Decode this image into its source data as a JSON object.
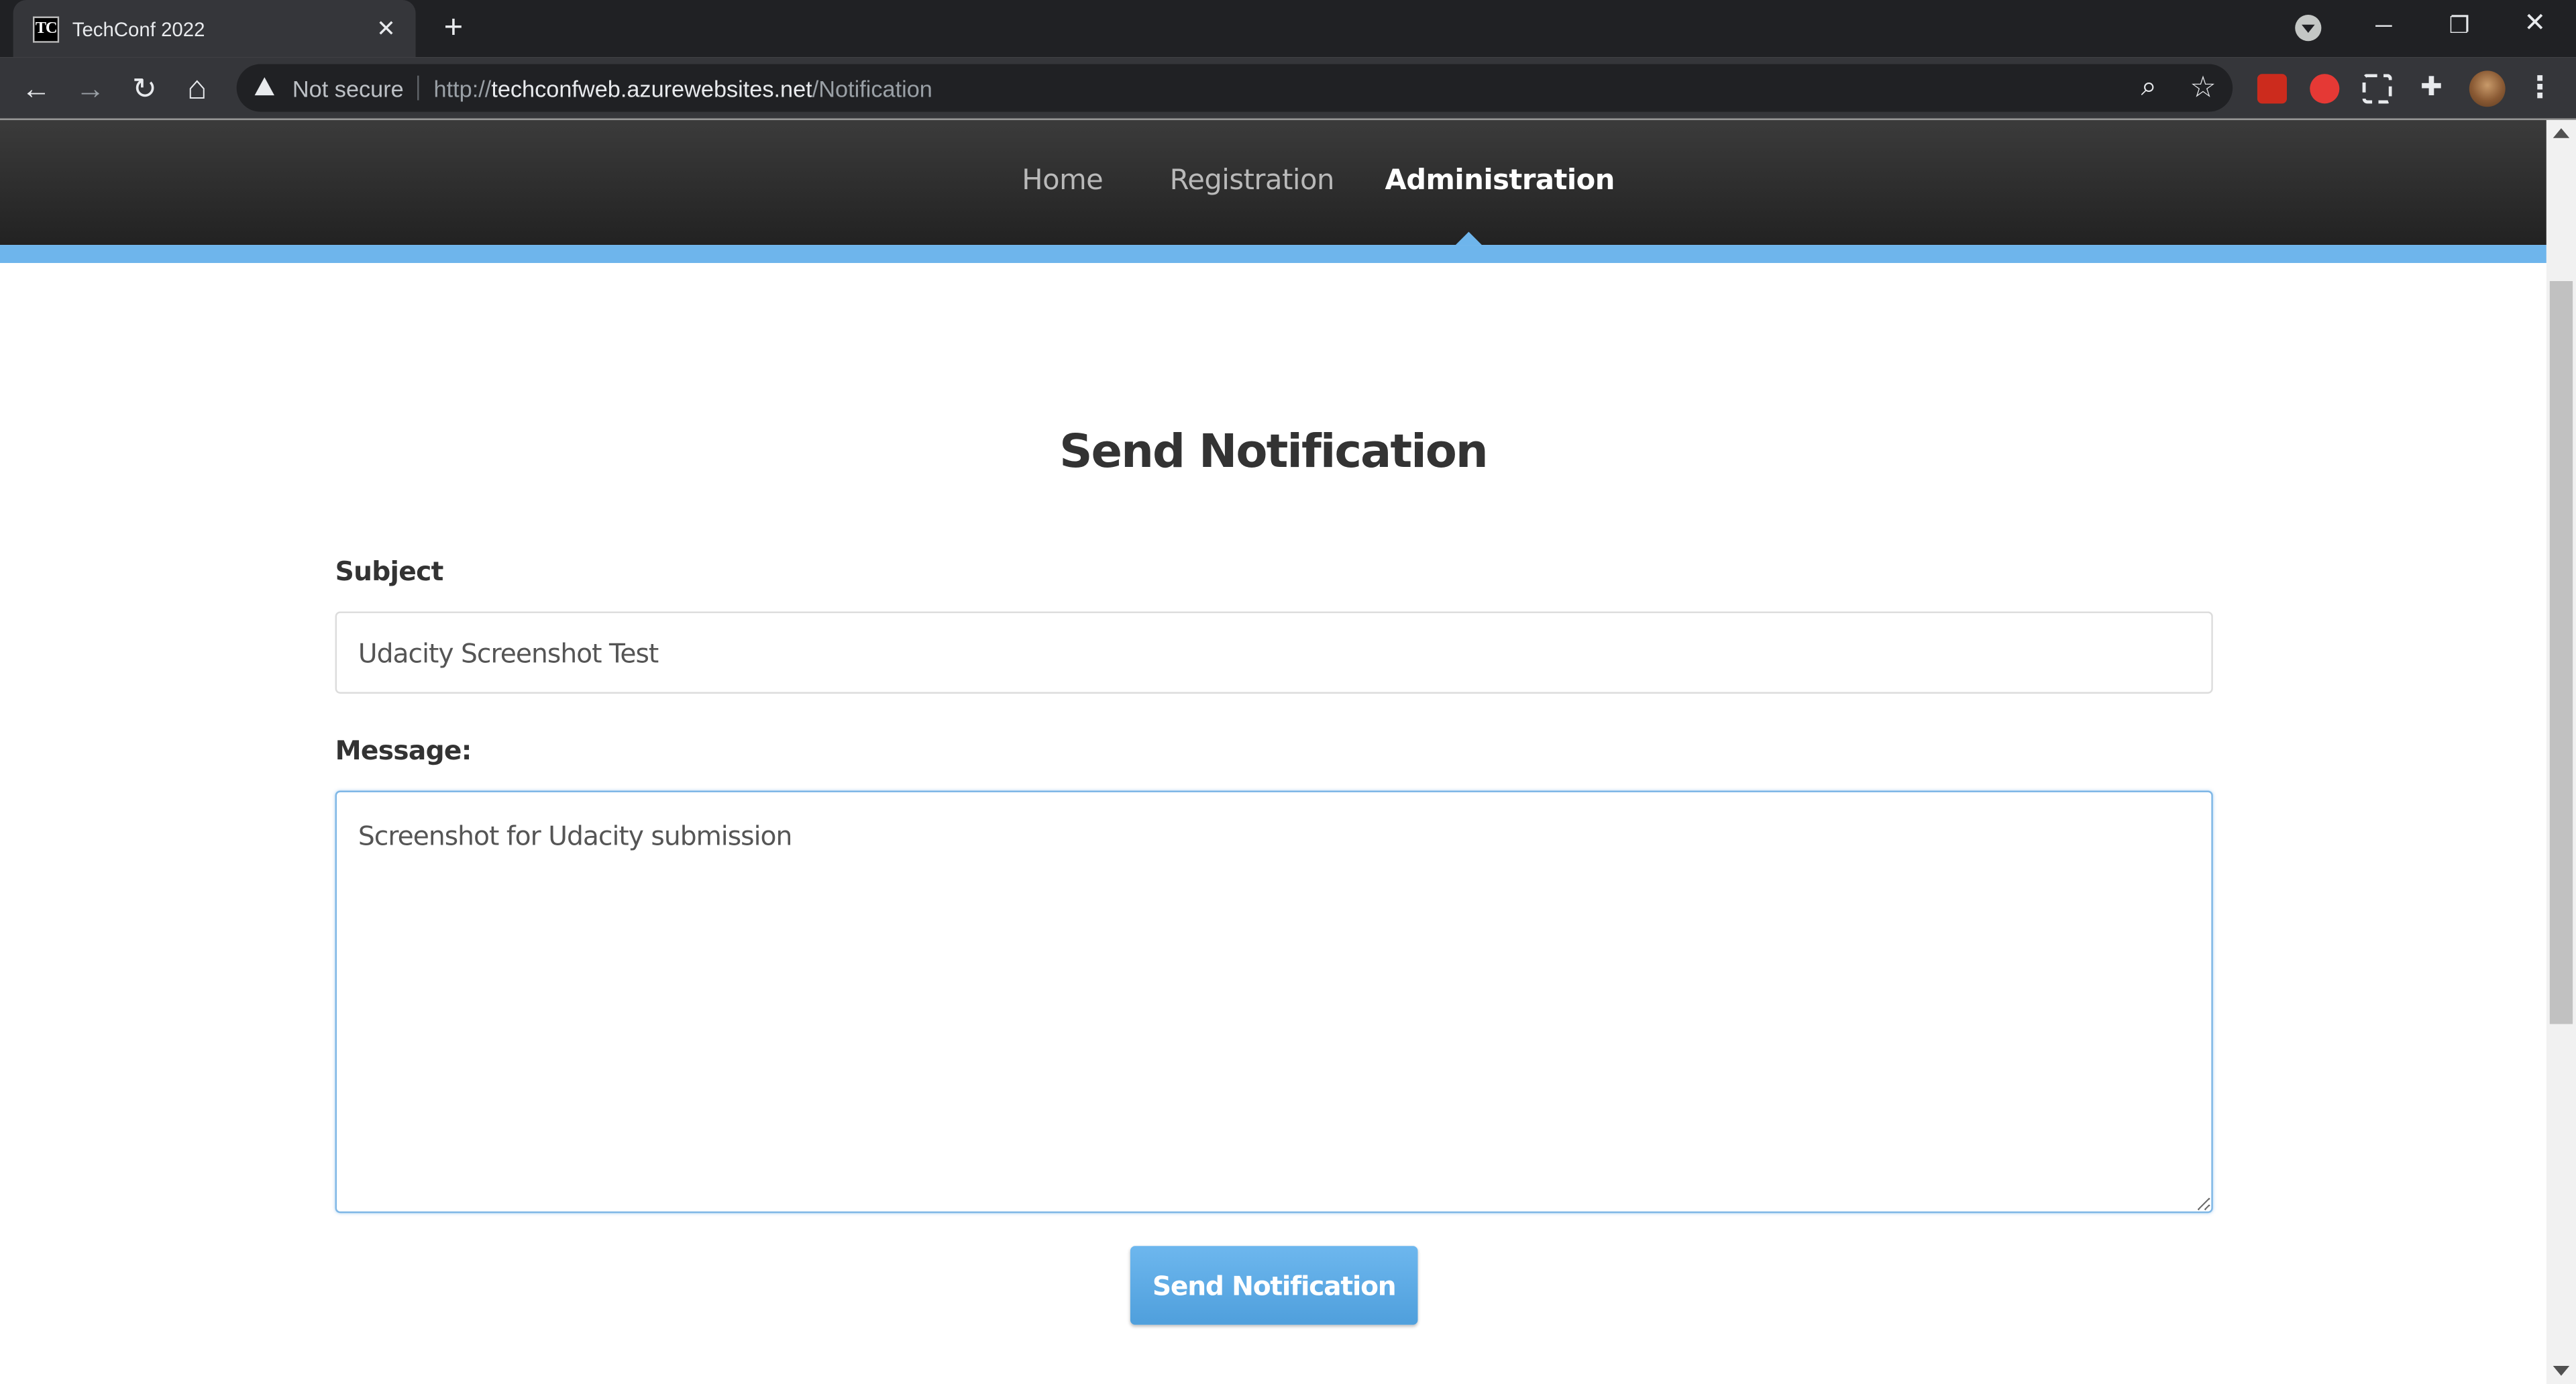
{
  "browser": {
    "tab": {
      "favicon_text": "TC",
      "title": "TechConf 2022",
      "close": "✕"
    },
    "new_tab": "+",
    "window_controls": {
      "minimize": "─",
      "restore": "❐",
      "close": "✕"
    },
    "nav": {
      "back": "←",
      "forward": "→",
      "reload": "↻",
      "home": "⌂"
    },
    "address": {
      "security_label": "Not secure",
      "scheme": "http://",
      "host": "techconfweb.azurewebsites.net",
      "path": "/Notification"
    },
    "omnibox_icons": {
      "zoom": "⌕",
      "bookmark": "☆"
    },
    "extensions": [
      {
        "name": "acrobat-extension-icon",
        "color": "#cc2b1d"
      },
      {
        "name": "adblock-extension-icon",
        "color": "#e53935"
      },
      {
        "name": "capture-extension-icon",
        "color": "#e8eaed"
      },
      {
        "name": "puzzle-extension-icon",
        "color": "#e8eaed"
      }
    ],
    "menu": "⋮"
  },
  "site_nav": {
    "items": [
      {
        "label": "Home",
        "active": false
      },
      {
        "label": "Registration",
        "active": false
      },
      {
        "label": "Administration",
        "active": true
      }
    ],
    "accent_color": "#6eb5ec"
  },
  "form": {
    "title": "Send Notification",
    "subject": {
      "label": "Subject",
      "value": "Udacity Screenshot Test"
    },
    "message": {
      "label": "Message:",
      "value": "Screenshot for Udacity submission"
    },
    "submit_label": "Send Notification"
  }
}
